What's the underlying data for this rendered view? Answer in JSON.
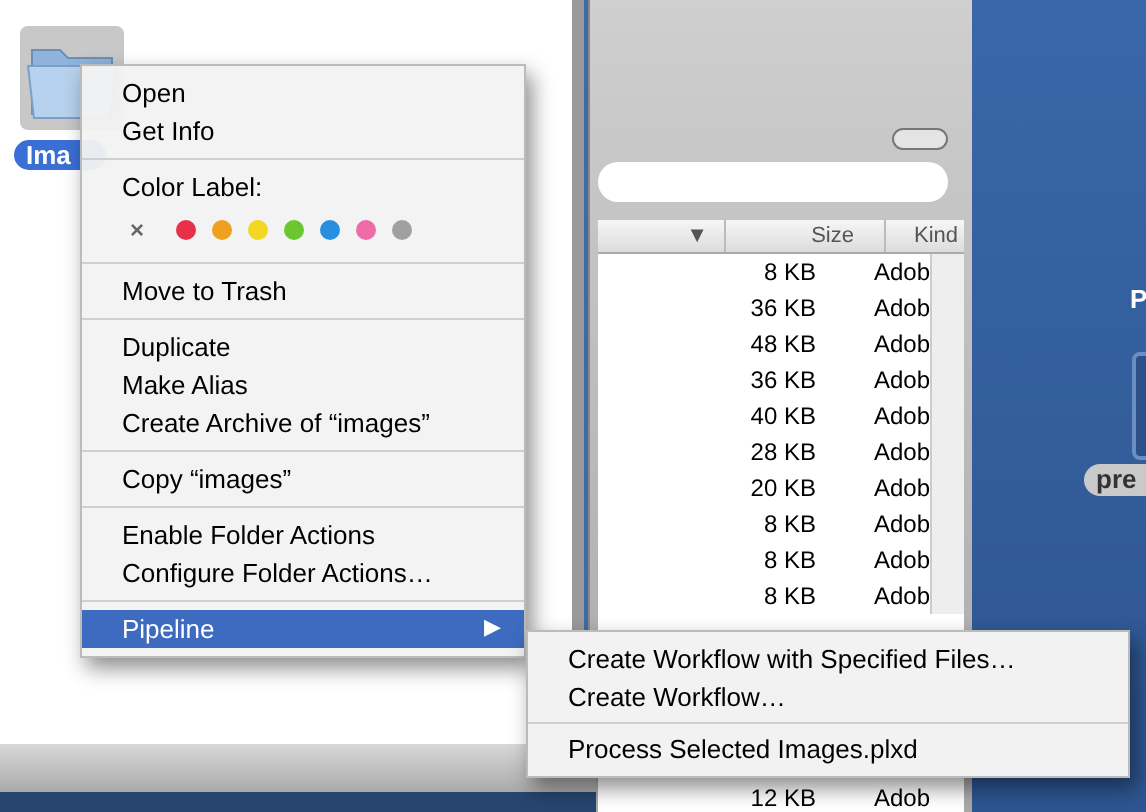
{
  "folder": {
    "label": "Ima"
  },
  "context_menu": {
    "groups": [
      {
        "items": [
          {
            "label": "Open",
            "selected": false
          },
          {
            "label": "Get Info",
            "selected": false
          }
        ]
      },
      {
        "kind": "colors",
        "title": "Color Label:",
        "clear": "×",
        "colors": [
          {
            "color": "#e8304a"
          },
          {
            "color": "#f0a020"
          },
          {
            "color": "#f2d820"
          },
          {
            "color": "#6cc630"
          },
          {
            "color": "#2a8ee0"
          },
          {
            "color": "#ee6aa8"
          },
          {
            "color": "#a0a0a0"
          }
        ]
      },
      {
        "items": [
          {
            "label": "Move to Trash",
            "selected": false
          }
        ]
      },
      {
        "items": [
          {
            "label": "Duplicate",
            "selected": false
          },
          {
            "label": "Make Alias",
            "selected": false
          },
          {
            "label": "Create Archive of “images”",
            "selected": false
          }
        ]
      },
      {
        "items": [
          {
            "label": "Copy “images”",
            "selected": false
          }
        ]
      },
      {
        "items": [
          {
            "label": "Enable Folder Actions",
            "selected": false
          },
          {
            "label": "Configure Folder Actions…",
            "selected": false
          }
        ]
      },
      {
        "items": [
          {
            "label": "Pipeline",
            "selected": true,
            "submenu_arrow": "▶"
          }
        ]
      }
    ]
  },
  "submenu": {
    "groups": [
      [
        {
          "label": "Create Workflow with Specified Files…"
        },
        {
          "label": "Create Workflow…"
        }
      ],
      [
        {
          "label": "Process Selected Images.plxd"
        }
      ]
    ]
  },
  "file_list": {
    "columns": [
      {
        "label": "▼"
      },
      {
        "label": "Size"
      },
      {
        "label": "Kind"
      }
    ],
    "rows": [
      {
        "size": "8 KB",
        "kind": "Adob"
      },
      {
        "size": "36 KB",
        "kind": "Adob"
      },
      {
        "size": "48 KB",
        "kind": "Adob"
      },
      {
        "size": "36 KB",
        "kind": "Adob"
      },
      {
        "size": "40 KB",
        "kind": "Adob"
      },
      {
        "size": "28 KB",
        "kind": "Adob"
      },
      {
        "size": "20 KB",
        "kind": "Adob"
      },
      {
        "size": "8 KB",
        "kind": "Adob"
      },
      {
        "size": "8 KB",
        "kind": "Adob"
      },
      {
        "size": "8 KB",
        "kind": "Adob"
      }
    ],
    "bottom_row": {
      "size": "12 KB",
      "kind": "Adob"
    }
  },
  "desktop": {
    "labels": [
      {
        "text": "P"
      }
    ],
    "icon_label": "pre"
  }
}
